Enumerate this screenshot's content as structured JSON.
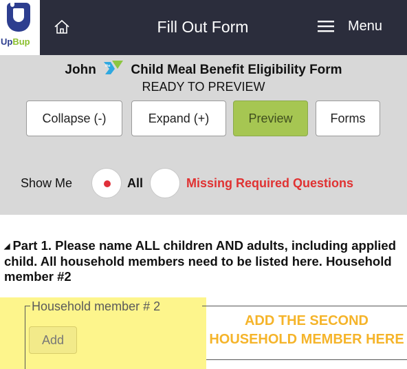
{
  "nav": {
    "logo_text_up": "Up",
    "logo_text_bup": "Bup",
    "title": "Fill Out Form",
    "menu_label": "Menu",
    "home_icon": "home-icon",
    "menu_icon": "hamburger-menu-icon"
  },
  "panel": {
    "form_title_name": "John",
    "form_title_rest": "Child Meal Benefit Eligibility Form",
    "status": "READY TO PREVIEW",
    "buttons": {
      "collapse": "Collapse (-)",
      "expand": "Expand (+)",
      "preview": "Preview",
      "forms": "Forms"
    },
    "show_me_label": "Show Me",
    "filter_all": "All",
    "filter_missing": "Missing Required Questions",
    "selected_filter": "All"
  },
  "part1": {
    "heading": "Part 1. Please name ALL children AND adults, including applied child. All household members need to be listed here. Household member #2"
  },
  "household": {
    "legend": "Household member # 2",
    "add_label": "Add",
    "callout": "ADD THE SECOND HOUSEHOLD MEMBER HERE"
  },
  "colors": {
    "nav_bg": "#2b2d3c",
    "panel_bg": "#d8d8d8",
    "preview_btn": "#a6c652",
    "missing_text": "#e03232",
    "highlight": "#fdf58c",
    "callout_text": "#f5b42a"
  }
}
